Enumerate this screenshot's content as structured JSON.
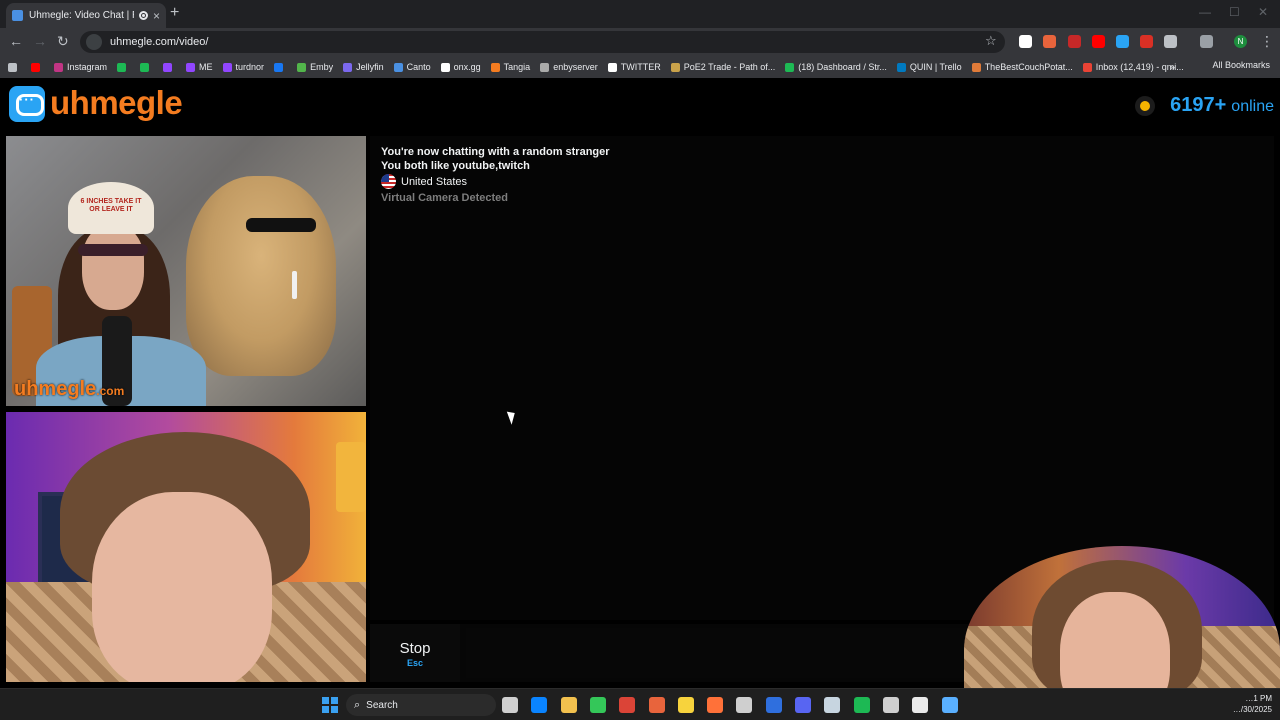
{
  "browser": {
    "tab_title": "Uhmegle: Video Chat | Random",
    "tab_close": "×",
    "new_tab": "+",
    "url": "uhmegle.com/video/",
    "back": "←",
    "forward": "→",
    "reload": "↻",
    "star": "☆",
    "win_min": "—",
    "win_max": "☐",
    "win_close": "✕",
    "profile_initial": "N",
    "bookmarks": [
      {
        "label": "",
        "color": "#ff0000"
      },
      {
        "label": "Instagram",
        "color": "#c13584"
      },
      {
        "label": "",
        "color": "#1db954"
      },
      {
        "label": "",
        "color": "#1db954"
      },
      {
        "label": "",
        "color": "#9146ff"
      },
      {
        "label": "ME",
        "color": "#9146ff"
      },
      {
        "label": "turdnor",
        "color": "#9146ff"
      },
      {
        "label": "",
        "color": "#1877f2"
      },
      {
        "label": "Emby",
        "color": "#52b54b"
      },
      {
        "label": "Jellyfin",
        "color": "#7b68ee"
      },
      {
        "label": "Canto",
        "color": "#4a90e2"
      },
      {
        "label": "onx.gg",
        "color": "#ffffff"
      },
      {
        "label": "Tangia",
        "color": "#f47c20"
      },
      {
        "label": "enbyserver",
        "color": "#aaaaaa"
      },
      {
        "label": "TWITTER",
        "color": "#ffffff"
      },
      {
        "label": "PoE2 Trade - Path of...",
        "color": "#c9a24a"
      },
      {
        "label": "(18) Dashboard / Str...",
        "color": "#1db954"
      },
      {
        "label": "QUIN | Trello",
        "color": "#0079bf"
      },
      {
        "label": "TheBestCouchPotat...",
        "color": "#e07b39"
      },
      {
        "label": "Inbox (12,419) - qmi...",
        "color": "#ea4335"
      }
    ],
    "more_bookmarks": "»",
    "all_bookmarks": "All Bookmarks"
  },
  "site": {
    "logo_text": "uhmegle",
    "online_count": "6197+",
    "online_label": "online"
  },
  "video": {
    "hat_text": "6 INCHES TAKE IT OR LEAVE IT",
    "watermark": "uhmegle",
    "watermark_suffix": ".com"
  },
  "chat": {
    "line1": "You're now chatting with a random stranger",
    "line2": "You both like youtube,twitch",
    "country": "United States",
    "warning": "Virtual Camera Detected"
  },
  "controls": {
    "stop_label": "Stop",
    "stop_shortcut": "Esc",
    "input_placeholder": ""
  },
  "taskbar": {
    "search_label": "Search",
    "clock_time": "…1 PM",
    "clock_date": "…/30/2025",
    "icons": [
      "#cfcfcf",
      "#0a84ff",
      "#f2c14e",
      "#34c759",
      "#db4437",
      "#e8643c",
      "#f7d33d",
      "#ff7139",
      "#cfcfcf",
      "#2f6fde",
      "#5865f2",
      "#c7d5e0",
      "#1db954",
      "#cfcfcf",
      "#eaeaea",
      "#5ab0ff"
    ]
  }
}
